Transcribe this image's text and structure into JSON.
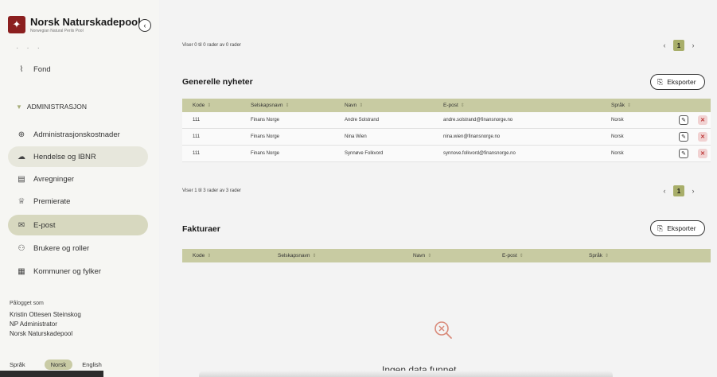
{
  "app": {
    "logo_title": "Norsk Naturskadepool",
    "logo_subtitle": "Norwegian Natural Perils Pool"
  },
  "sidebar": {
    "fond_label": "Fond",
    "section_title": "ADMINISTRASJON",
    "items": [
      {
        "label": "Administrasjonskostnader",
        "icon": "coins-icon"
      },
      {
        "label": "Hendelse og IBNR",
        "icon": "cloud-icon"
      },
      {
        "label": "Avregninger",
        "icon": "document-icon"
      },
      {
        "label": "Premierate",
        "icon": "trophy-icon"
      },
      {
        "label": "E-post",
        "icon": "mail-icon"
      },
      {
        "label": "Brukere og roller",
        "icon": "users-icon"
      },
      {
        "label": "Kommuner og fylker",
        "icon": "map-icon"
      }
    ],
    "user": {
      "label": "Pålogget som",
      "name": "Kristin Ottesen Steinskog",
      "role": "NP Administrator",
      "org": "Norsk Naturskadepool"
    },
    "language": {
      "label": "Språk",
      "selected": "Norsk",
      "other": "English"
    }
  },
  "main": {
    "top_info": "Viser 0 til 0 rader av 0 rader",
    "page_number": "1",
    "section1": {
      "title": "Generelle nyheter",
      "export_label": "Eksporter",
      "columns": [
        "Kode",
        "Selskapsnavn",
        "Navn",
        "E-post",
        "Språk"
      ],
      "rows": [
        [
          "111",
          "Finans Norge",
          "Andre Solstrand",
          "andre.solstrand@finansnorge.no",
          "Norsk"
        ],
        [
          "111",
          "Finans Norge",
          "Nina Wien",
          "nina.wien@finansnorge.no",
          "Norsk"
        ],
        [
          "111",
          "Finans Norge",
          "Synnøve Folkvord",
          "synnove.folkvord@finansnorge.no",
          "Norsk"
        ]
      ],
      "info": "Viser 1 til 3 rader av 3 rader"
    },
    "section2": {
      "title": "Fakturaer",
      "export_label": "Eksporter",
      "columns": [
        "Kode",
        "Selskapsnavn",
        "Navn",
        "E-post",
        "Språk"
      ],
      "empty_text": "Ingen data funnet"
    }
  },
  "colors": {
    "accent": "#a8ae6a",
    "header_bg": "#c8cba2",
    "active_nav": "#d7d8bf"
  }
}
